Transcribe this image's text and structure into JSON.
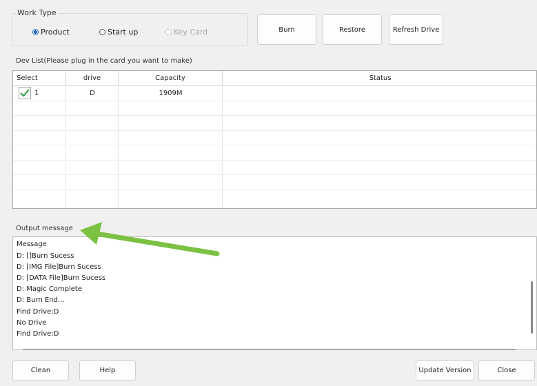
{
  "work_type": {
    "title": "Work Type",
    "options": [
      {
        "label": "Product",
        "selected": true,
        "enabled": true
      },
      {
        "label": "Start up",
        "selected": false,
        "enabled": true
      },
      {
        "label": "Key Card",
        "selected": false,
        "enabled": false
      }
    ]
  },
  "actions": {
    "burn": "Burn",
    "restore": "Restore",
    "refresh_drive": "Refresh Drive"
  },
  "dev_list": {
    "title": "Dev List(Please plug in the card you want to make)",
    "columns": [
      "Select",
      "drive",
      "Capacity",
      "Status"
    ],
    "rows": [
      {
        "checked": true,
        "index": "1",
        "drive": "D",
        "capacity": "1909M",
        "status": ""
      }
    ]
  },
  "output": {
    "title": "Output message",
    "lines": [
      "Message",
      "D: []Burn Sucess",
      "D: [IMG File]Burn Sucess",
      "D: [DATA File]Burn Sucess",
      "D: Magic Complete",
      "D: Burn End...",
      "Find Drive:D",
      "No Drive",
      "Find Drive:D"
    ]
  },
  "footer": {
    "clean": "Clean",
    "help": "Help",
    "update_version": "Update Version",
    "close": "Close"
  },
  "colors": {
    "annotation_arrow": "#7cc142",
    "check_mark": "#2e9e3e",
    "radio_selected": "#1a5fb4"
  }
}
